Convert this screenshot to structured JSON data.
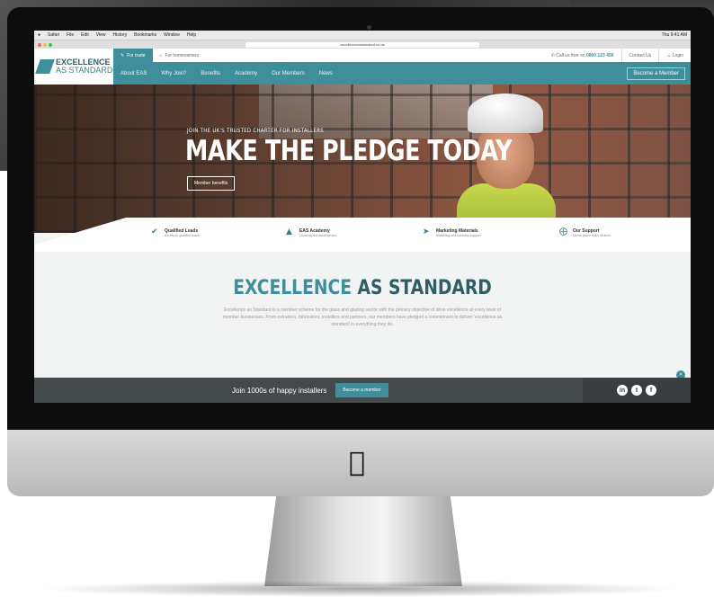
{
  "menubar": {
    "items": [
      "Safari",
      "File",
      "Edit",
      "View",
      "History",
      "Bookmarks",
      "Window",
      "Help"
    ],
    "status": "Thu 9:41 AM"
  },
  "browser": {
    "url": "excellenceasstandard.co.uk"
  },
  "logo": {
    "line1": "EXCELLENCE",
    "line2": "AS STANDARD"
  },
  "topbar": {
    "trade_tab": "For trade",
    "home_tab": "For homeowners",
    "call_label": "Call us free on",
    "call_number": "0800 123 456",
    "contact": "Contact Us",
    "login": "Login"
  },
  "nav": {
    "items": [
      "About EAS",
      "Why Join?",
      "Benefits",
      "Academy",
      "Our Members",
      "News"
    ],
    "cta": "Become a Member"
  },
  "hero": {
    "kicker": "JOIN THE UK'S TRUSTED CHARTER FOR INSTALLERS",
    "headline": "MAKE THE PLEDGE TODAY",
    "button": "Member benefits"
  },
  "features": [
    {
      "icon": "checkmark-icon",
      "title": "Qualified Leads",
      "subtitle": "Access to qualified leads"
    },
    {
      "icon": "graduation-cap-icon",
      "title": "EAS Academy",
      "subtitle": "Learning and development"
    },
    {
      "icon": "megaphone-icon",
      "title": "Marketing Materials",
      "subtitle": "Marketing and business support"
    },
    {
      "icon": "lifebuoy-icon",
      "title": "Our Support",
      "subtitle": "Lorem ipsum dolor sit amet"
    }
  ],
  "intro": {
    "title_accent": "EXCELLENCE",
    "title_rest": "AS STANDARD",
    "body": "Excellence as Standard is a member scheme for the glass and glazing sector with the primary objective of drive excellence at every level of member businesses. From extruders, fabricators, installers and partners, our members have pledged a commitment to deliver 'excellence as standard' in everything they do."
  },
  "footer": {
    "join_text": "Join 1000s of happy installers",
    "button": "Become a member",
    "social": [
      "in",
      "t",
      "f"
    ]
  },
  "colors": {
    "brand": "#3e8f9b",
    "footer": "#44494b"
  }
}
